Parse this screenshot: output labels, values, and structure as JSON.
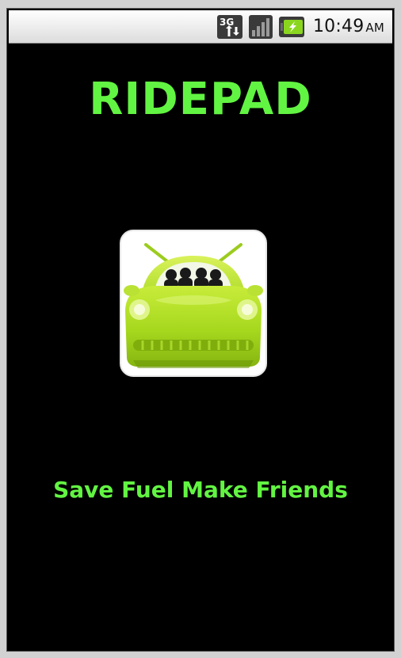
{
  "status_bar": {
    "network_type": "3G",
    "time": "10:49",
    "ampm": "AM",
    "icons": [
      "network-3g-icon",
      "signal-icon",
      "battery-charging-icon"
    ]
  },
  "app": {
    "title": "RIDEPAD",
    "tagline": "Save Fuel Make Friends",
    "logo_icon": "car-with-passengers-icon"
  },
  "colors": {
    "accent": "#62f442",
    "background": "#000000",
    "logo_green": "#9fd21a"
  }
}
